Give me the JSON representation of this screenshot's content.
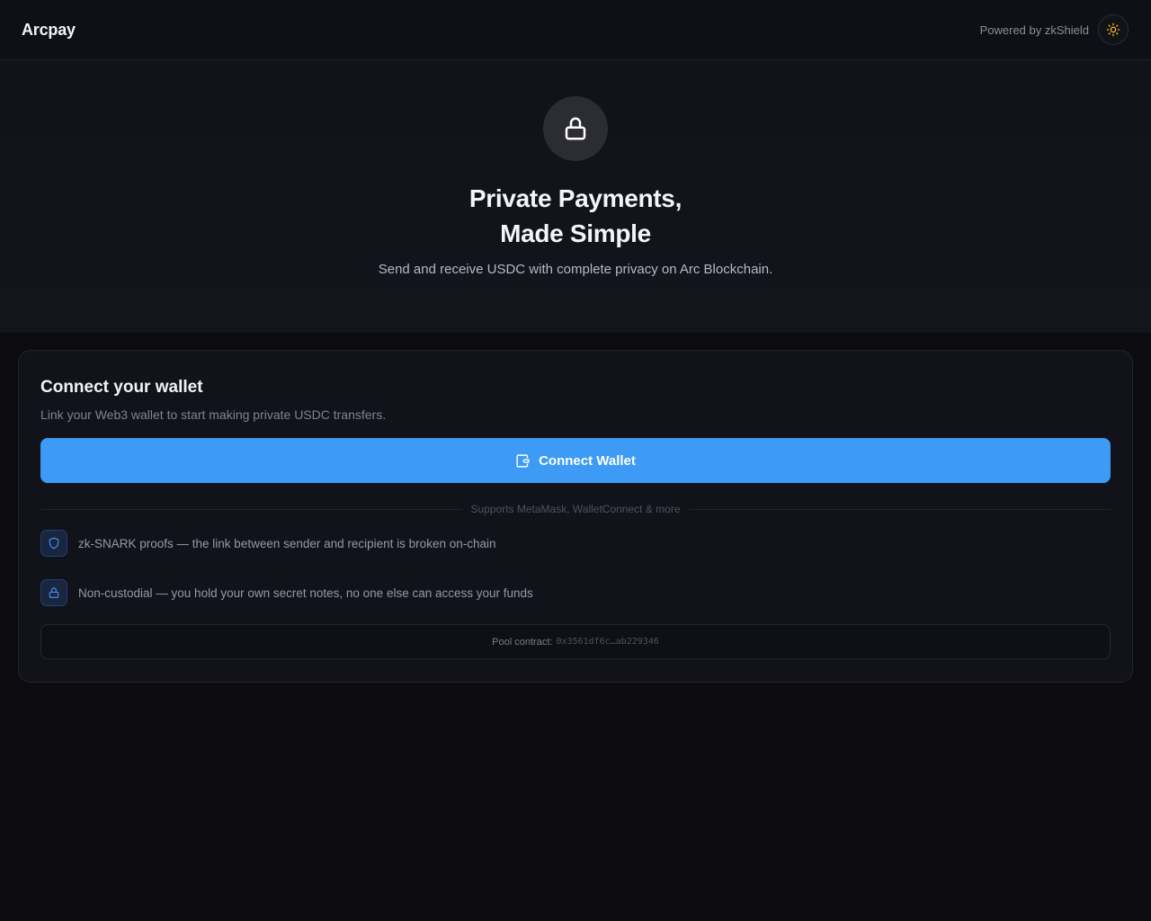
{
  "header": {
    "brand": "Arcpay",
    "powered_by": "Powered by zkShield",
    "theme_icon": "sun-icon"
  },
  "hero": {
    "icon": "lock-icon",
    "title_line1": "Private Payments,",
    "title_line2": "Made Simple",
    "subtitle": "Send and receive USDC with complete privacy on Arc Blockchain."
  },
  "card": {
    "title": "Connect your wallet",
    "subtitle": "Link your Web3 wallet to start making private USDC transfers.",
    "connect_button": "Connect Wallet",
    "connect_icon": "wallet-icon",
    "supports": "Supports MetaMask, WalletConnect & more",
    "features": [
      {
        "icon": "shield-icon",
        "text": "zk-SNARK proofs — the link between sender and recipient is broken on-chain"
      },
      {
        "icon": "lock-icon",
        "text": "Non-custodial — you hold your own secret notes, no one else can access your funds"
      }
    ],
    "pool_label": "Pool contract:",
    "pool_address": "0x3561df6c…ab229346"
  },
  "colors": {
    "accent": "#3d9bf5",
    "background": "#0b0b10",
    "card": "#12131a",
    "sun": "#f0b429"
  }
}
